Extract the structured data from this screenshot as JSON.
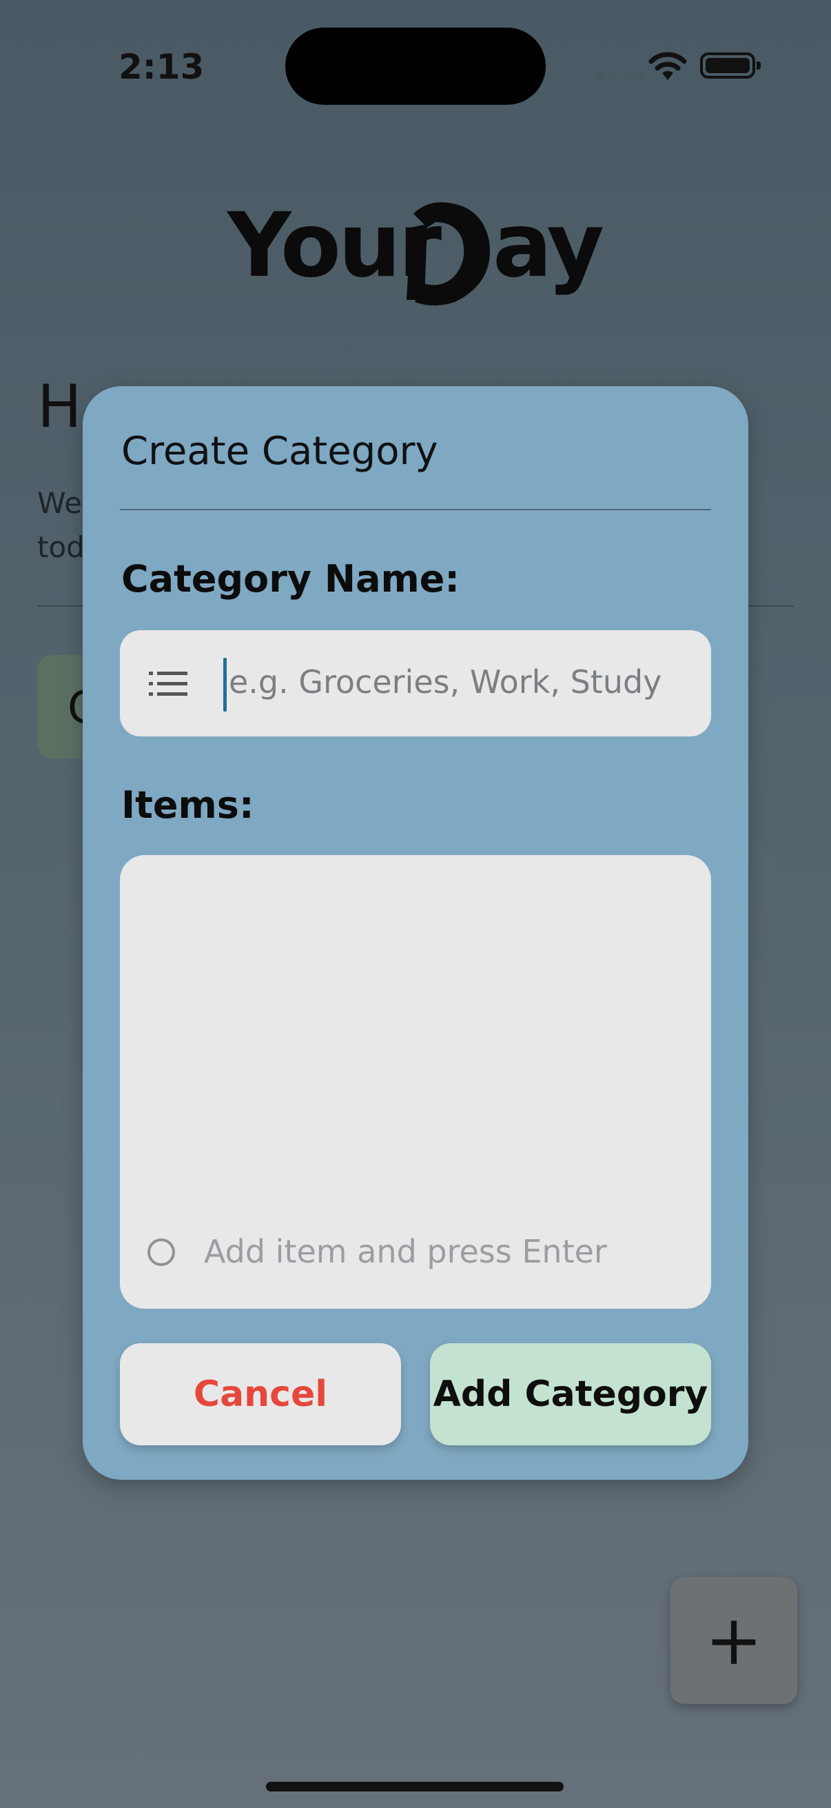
{
  "status_bar": {
    "time": "2:13"
  },
  "background": {
    "logo": {
      "text_left": "Your",
      "text_right": "ay"
    },
    "greeting": "H",
    "subtitle_line1": "We",
    "subtitle_line2": "tod",
    "card_letter": "C"
  },
  "modal": {
    "title": "Create Category",
    "name_label": "Category Name:",
    "name_placeholder": "e.g. Groceries, Work, Study",
    "items_label": "Items:",
    "item_placeholder": "Add item and press Enter",
    "cancel_label": "Cancel",
    "add_label": "Add Category"
  },
  "fab": {
    "symbol": "+"
  },
  "colors": {
    "modal_bg": "#7fa8c2",
    "input_bg": "#e8e8e8",
    "cancel_text": "#e5483a",
    "add_button_bg": "#c4e2d0",
    "caret": "#1f6f98"
  }
}
